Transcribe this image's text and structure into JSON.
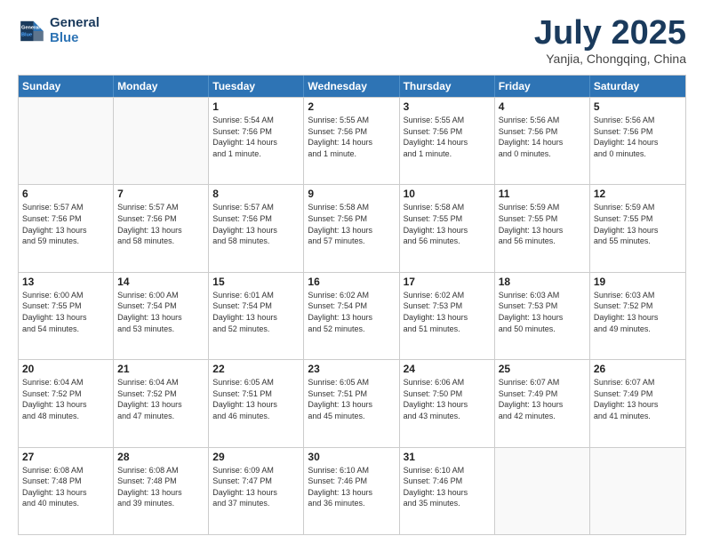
{
  "header": {
    "logo_line1": "General",
    "logo_line2": "Blue",
    "month": "July 2025",
    "location": "Yanjia, Chongqing, China"
  },
  "days_of_week": [
    "Sunday",
    "Monday",
    "Tuesday",
    "Wednesday",
    "Thursday",
    "Friday",
    "Saturday"
  ],
  "weeks": [
    [
      {
        "day": "",
        "empty": true
      },
      {
        "day": "",
        "empty": true
      },
      {
        "day": "1",
        "info": "Sunrise: 5:54 AM\nSunset: 7:56 PM\nDaylight: 14 hours\nand 1 minute."
      },
      {
        "day": "2",
        "info": "Sunrise: 5:55 AM\nSunset: 7:56 PM\nDaylight: 14 hours\nand 1 minute."
      },
      {
        "day": "3",
        "info": "Sunrise: 5:55 AM\nSunset: 7:56 PM\nDaylight: 14 hours\nand 1 minute."
      },
      {
        "day": "4",
        "info": "Sunrise: 5:56 AM\nSunset: 7:56 PM\nDaylight: 14 hours\nand 0 minutes."
      },
      {
        "day": "5",
        "info": "Sunrise: 5:56 AM\nSunset: 7:56 PM\nDaylight: 14 hours\nand 0 minutes."
      }
    ],
    [
      {
        "day": "6",
        "info": "Sunrise: 5:57 AM\nSunset: 7:56 PM\nDaylight: 13 hours\nand 59 minutes."
      },
      {
        "day": "7",
        "info": "Sunrise: 5:57 AM\nSunset: 7:56 PM\nDaylight: 13 hours\nand 58 minutes."
      },
      {
        "day": "8",
        "info": "Sunrise: 5:57 AM\nSunset: 7:56 PM\nDaylight: 13 hours\nand 58 minutes."
      },
      {
        "day": "9",
        "info": "Sunrise: 5:58 AM\nSunset: 7:56 PM\nDaylight: 13 hours\nand 57 minutes."
      },
      {
        "day": "10",
        "info": "Sunrise: 5:58 AM\nSunset: 7:55 PM\nDaylight: 13 hours\nand 56 minutes."
      },
      {
        "day": "11",
        "info": "Sunrise: 5:59 AM\nSunset: 7:55 PM\nDaylight: 13 hours\nand 56 minutes."
      },
      {
        "day": "12",
        "info": "Sunrise: 5:59 AM\nSunset: 7:55 PM\nDaylight: 13 hours\nand 55 minutes."
      }
    ],
    [
      {
        "day": "13",
        "info": "Sunrise: 6:00 AM\nSunset: 7:55 PM\nDaylight: 13 hours\nand 54 minutes."
      },
      {
        "day": "14",
        "info": "Sunrise: 6:00 AM\nSunset: 7:54 PM\nDaylight: 13 hours\nand 53 minutes."
      },
      {
        "day": "15",
        "info": "Sunrise: 6:01 AM\nSunset: 7:54 PM\nDaylight: 13 hours\nand 52 minutes."
      },
      {
        "day": "16",
        "info": "Sunrise: 6:02 AM\nSunset: 7:54 PM\nDaylight: 13 hours\nand 52 minutes."
      },
      {
        "day": "17",
        "info": "Sunrise: 6:02 AM\nSunset: 7:53 PM\nDaylight: 13 hours\nand 51 minutes."
      },
      {
        "day": "18",
        "info": "Sunrise: 6:03 AM\nSunset: 7:53 PM\nDaylight: 13 hours\nand 50 minutes."
      },
      {
        "day": "19",
        "info": "Sunrise: 6:03 AM\nSunset: 7:52 PM\nDaylight: 13 hours\nand 49 minutes."
      }
    ],
    [
      {
        "day": "20",
        "info": "Sunrise: 6:04 AM\nSunset: 7:52 PM\nDaylight: 13 hours\nand 48 minutes."
      },
      {
        "day": "21",
        "info": "Sunrise: 6:04 AM\nSunset: 7:52 PM\nDaylight: 13 hours\nand 47 minutes."
      },
      {
        "day": "22",
        "info": "Sunrise: 6:05 AM\nSunset: 7:51 PM\nDaylight: 13 hours\nand 46 minutes."
      },
      {
        "day": "23",
        "info": "Sunrise: 6:05 AM\nSunset: 7:51 PM\nDaylight: 13 hours\nand 45 minutes."
      },
      {
        "day": "24",
        "info": "Sunrise: 6:06 AM\nSunset: 7:50 PM\nDaylight: 13 hours\nand 43 minutes."
      },
      {
        "day": "25",
        "info": "Sunrise: 6:07 AM\nSunset: 7:49 PM\nDaylight: 13 hours\nand 42 minutes."
      },
      {
        "day": "26",
        "info": "Sunrise: 6:07 AM\nSunset: 7:49 PM\nDaylight: 13 hours\nand 41 minutes."
      }
    ],
    [
      {
        "day": "27",
        "info": "Sunrise: 6:08 AM\nSunset: 7:48 PM\nDaylight: 13 hours\nand 40 minutes."
      },
      {
        "day": "28",
        "info": "Sunrise: 6:08 AM\nSunset: 7:48 PM\nDaylight: 13 hours\nand 39 minutes."
      },
      {
        "day": "29",
        "info": "Sunrise: 6:09 AM\nSunset: 7:47 PM\nDaylight: 13 hours\nand 37 minutes."
      },
      {
        "day": "30",
        "info": "Sunrise: 6:10 AM\nSunset: 7:46 PM\nDaylight: 13 hours\nand 36 minutes."
      },
      {
        "day": "31",
        "info": "Sunrise: 6:10 AM\nSunset: 7:46 PM\nDaylight: 13 hours\nand 35 minutes."
      },
      {
        "day": "",
        "empty": true
      },
      {
        "day": "",
        "empty": true
      }
    ]
  ]
}
